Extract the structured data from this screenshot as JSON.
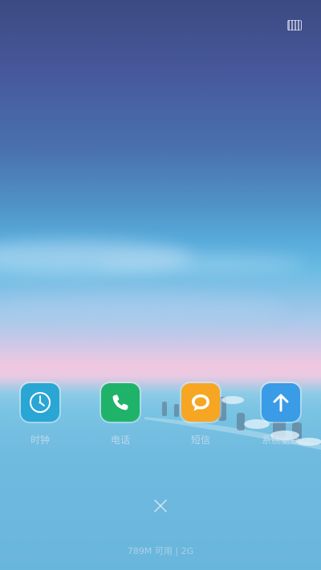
{
  "status_bar": {
    "battery_icon": "battery-icon"
  },
  "recent_apps": [
    {
      "label": "时钟",
      "icon": "clock-icon",
      "color": "#2aa6d4"
    },
    {
      "label": "电话",
      "icon": "phone-icon",
      "color": "#1fb36a"
    },
    {
      "label": "短信",
      "icon": "message-icon",
      "color": "#f6a623"
    },
    {
      "label": "系统更新",
      "icon": "update-arrow-icon",
      "color": "#3a9be6"
    }
  ],
  "controls": {
    "clear_icon": "close-icon"
  },
  "footer": {
    "memory_text": "789M 可用 | 2G"
  }
}
